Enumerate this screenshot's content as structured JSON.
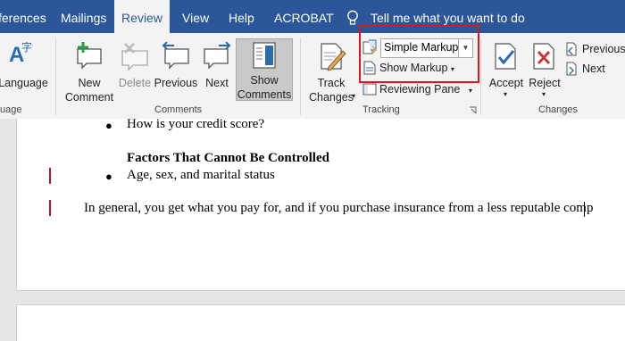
{
  "tabs": [
    "ferences",
    "Mailings",
    "Review",
    "View",
    "Help",
    "ACROBAT"
  ],
  "tell_me": "Tell me what you want to do",
  "ribbon": {
    "language_label": "Language",
    "language_group_partial": "uage",
    "new_comment": [
      "New",
      "Comment"
    ],
    "delete": "Delete",
    "previous": "Previous",
    "next": "Next",
    "show_comments": [
      "Show",
      "Comments"
    ],
    "comments_group": "Comments",
    "track_changes": [
      "Track",
      "Changes"
    ],
    "markup_select": "Simple Markup",
    "show_markup": "Show Markup",
    "reviewing_pane": "Reviewing Pane",
    "tracking_group": "Tracking",
    "accept": "Accept",
    "reject": "Reject",
    "prev_change": "Previous",
    "next_change": "Next",
    "changes_group": "Changes"
  },
  "document": {
    "bullet1": "How is your credit score?",
    "heading": "Factors That Cannot Be Controlled",
    "bullet2": "Age, sex, and marital status",
    "paragraph": "In general, you get what you pay for, and if you purchase insurance from a less reputable comp"
  },
  "colors": {
    "ribbon_blue": "#2b579a",
    "highlight_red": "#e0141e",
    "change_bar": "#c8102e"
  }
}
